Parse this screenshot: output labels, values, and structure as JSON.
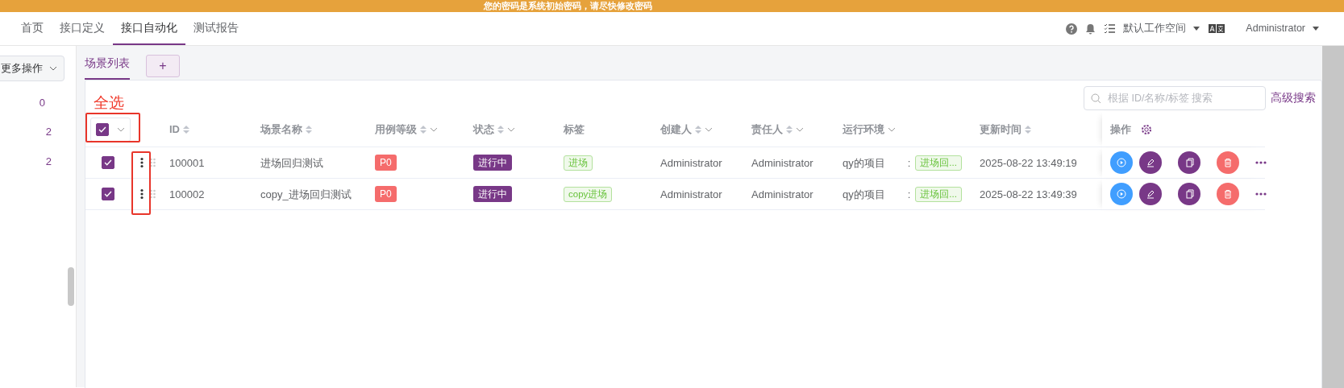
{
  "banner": {
    "text": "您的密码是系统初始密码，请尽快修改密码"
  },
  "nav": [
    {
      "label": "首页",
      "selected": false
    },
    {
      "label": "接口定义",
      "selected": false
    },
    {
      "label": "接口自动化",
      "selected": true
    },
    {
      "label": "测试报告",
      "selected": false
    }
  ],
  "header_right": {
    "workspace": "默认工作空间",
    "user": "Administrator"
  },
  "sidebar": {
    "more_button": "更多操作",
    "counts": [
      "0",
      "2",
      "2"
    ]
  },
  "tabs": [
    {
      "label": "场景列表",
      "selected": true
    }
  ],
  "add_tab": "+",
  "search": {
    "placeholder": "根据 ID/名称/标签 搜索"
  },
  "advanced_search": "高级搜索",
  "annotation": "全选",
  "select_all": {
    "checked": true
  },
  "columns": [
    {
      "label": "ID",
      "sortable": true,
      "filterable": false
    },
    {
      "label": "场景名称",
      "sortable": true,
      "filterable": false
    },
    {
      "label": "用例等级",
      "sortable": true,
      "filterable": true
    },
    {
      "label": "状态",
      "sortable": true,
      "filterable": true
    },
    {
      "label": "标签",
      "sortable": false,
      "filterable": false
    },
    {
      "label": "创建人",
      "sortable": true,
      "filterable": true
    },
    {
      "label": "责任人",
      "sortable": true,
      "filterable": true
    },
    {
      "label": "运行环境",
      "sortable": false,
      "filterable": true
    },
    {
      "label": "更新时间",
      "sortable": true,
      "filterable": false
    },
    {
      "label": "操作",
      "sortable": false,
      "filterable": false
    }
  ],
  "rows": [
    {
      "checked": true,
      "id": "100001",
      "name": "进场回归测试",
      "level": "P0",
      "status": "进行中",
      "tag": "进场",
      "creator": "Administrator",
      "owner": "Administrator",
      "env": "qy的项目",
      "env_separator": ":",
      "env_tag": "进场回...",
      "updated": "2025-08-22 13:49:19"
    },
    {
      "checked": true,
      "id": "100002",
      "name": "copy_进场回归测试",
      "level": "P0",
      "status": "进行中",
      "tag": "copy进场",
      "creator": "Administrator",
      "owner": "Administrator",
      "env": "qy的项目",
      "env_separator": ":",
      "env_tag": "进场回...",
      "updated": "2025-08-22 13:49:39"
    }
  ]
}
